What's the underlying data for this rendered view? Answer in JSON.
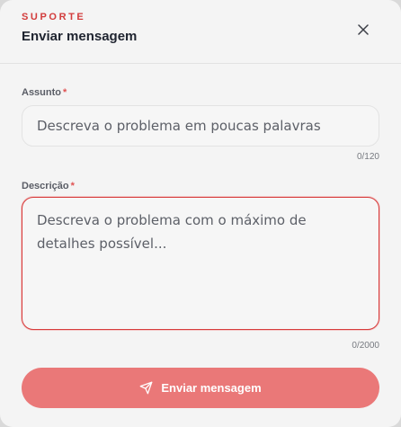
{
  "header": {
    "eyebrow": "SUPORTE",
    "title": "Enviar mensagem",
    "close_icon": "close-icon"
  },
  "form": {
    "subject": {
      "label": "Assunto",
      "required_mark": "*",
      "value": "",
      "placeholder": "Descreva o problema em poucas palavras",
      "counter": "0/120"
    },
    "description": {
      "label": "Descrição",
      "required_mark": "*",
      "value": "",
      "placeholder": "Descreva o problema com o máximo de detalhes possível...",
      "counter": "0/2000"
    },
    "submit": {
      "label": "Enviar mensagem",
      "icon": "send-icon"
    }
  },
  "colors": {
    "accent": "#d23c3c",
    "button_bg": "#ea7878",
    "required": "#e05252",
    "textarea_border": "#d73b3b"
  }
}
